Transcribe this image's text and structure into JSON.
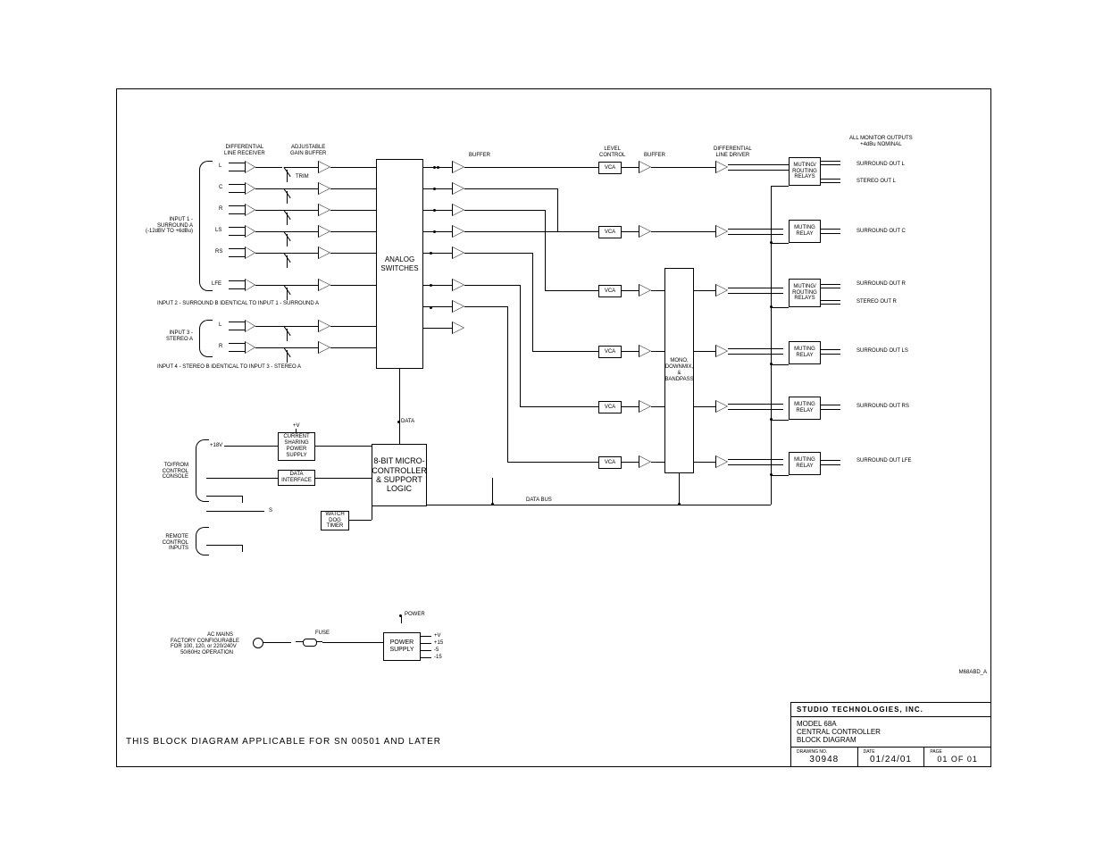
{
  "title_block": {
    "company": "STUDIO TECHNOLOGIES, INC.",
    "model": "MODEL 68A",
    "line2": "CENTRAL CONTROLLER",
    "line3": "BLOCK DIAGRAM",
    "drawing_no_label": "DRAWING NO.",
    "drawing_no": "30948",
    "date_label": "DATE",
    "date": "01/24/01",
    "page_label": "PAGE",
    "page": "01  OF  01"
  },
  "revision": "M68ABD_A",
  "footer_note": "THIS BLOCK DIAGRAM APPLICABLE FOR SN 00501 AND LATER",
  "headers": {
    "diff_recv": "DIFFERENTIAL\nLINE RECEIVER",
    "gain_buf": "ADJUSTABLE\nGAIN BUFFER",
    "buffer": "BUFFER",
    "level_ctrl": "LEVEL\nCONTROL",
    "buffer2": "BUFFER",
    "diff_drv": "DIFFERENTIAL\nLINE DRIVER",
    "all_mon": "ALL MONITOR OUTPUTS\n+4dBu NOMINAL"
  },
  "input_labels": {
    "in1": "INPUT 1 -\nSURROUND A\n(-12dBV TO +6dBu)",
    "in2_note": "INPUT 2 - SURROUND B IDENTICAL TO INPUT 1 - SURROUND A",
    "in3": "INPUT 3 -\nSTEREO A",
    "in4_note": "INPUT 4 - STEREO B IDENTICAL TO INPUT 3 - STEREO A"
  },
  "channels_in": [
    "L",
    "C",
    "R",
    "LS",
    "RS",
    "LFE"
  ],
  "stereo_in": [
    "L",
    "R"
  ],
  "trim_label": "TRIM",
  "blocks": {
    "analog_sw": "ANALOG\nSWITCHES",
    "mono_mix": "MONO,\nDOWNMIX, &\nBANDPASS",
    "mcu": "8-BIT\nMICRO-\nCONTROLLER\n& SUPPORT\nLOGIC",
    "psu_share": "CURRENT\nSHARING\nPOWER\nSUPPLY",
    "data_if": "DATA\nINTERFACE",
    "watchdog": "WATCH\nDOG\nTIMER",
    "power_supply": "POWER\nSUPPLY"
  },
  "relays": {
    "route": "MUTING/\nROUTING\nRELAYS",
    "mute": "MUTING\nRELAY"
  },
  "outputs": [
    "SURROUND OUT L",
    "STEREO OUT L",
    "SURROUND OUT C",
    "SURROUND OUT R",
    "STEREO OUT R",
    "SURROUND OUT LS",
    "SURROUND OUT RS",
    "SURROUND OUT LFE"
  ],
  "vca": "VCA",
  "side_labels": {
    "to_from": "TO/FROM\nCONTROL\nCONSOLE",
    "remote": "REMOTE\nCONTROL\nINPUTS",
    "plus18": "+18V",
    "s": "S",
    "data_bus": "DATA BUS",
    "data_tap": "DATA",
    "power_tap": "POWER",
    "plusV": "+V",
    "ac_mains": "AC MAINS\nFACTORY CONFIGURABLE\nFOR 100, 120, or 220/240V\n50/60Hz OPERATION",
    "fuse": "FUSE",
    "rails": [
      "+V",
      "+15",
      "-5",
      "-15"
    ]
  }
}
